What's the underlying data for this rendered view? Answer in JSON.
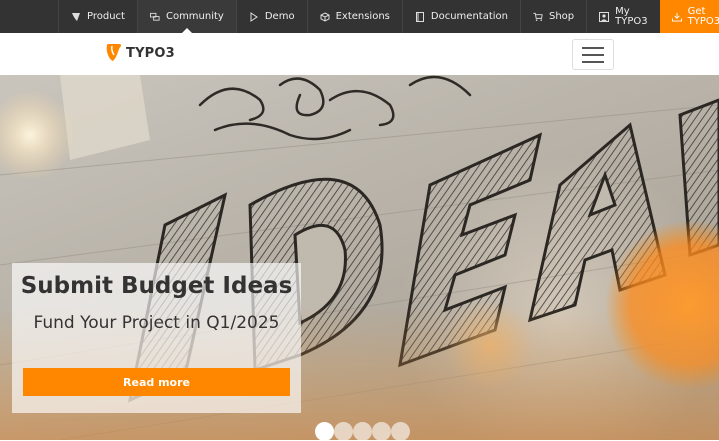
{
  "topnav": {
    "items": [
      {
        "label": "Product",
        "icon": "typo3-icon"
      },
      {
        "label": "Community",
        "icon": "community-icon"
      },
      {
        "label": "Demo",
        "icon": "play-icon"
      },
      {
        "label": "Extensions",
        "icon": "cube-icon"
      },
      {
        "label": "Documentation",
        "icon": "book-icon"
      },
      {
        "label": "Shop",
        "icon": "cart-icon"
      },
      {
        "label": "My TYPO3",
        "icon": "user-icon"
      }
    ],
    "cta": {
      "label": "Get TYPO3",
      "icon": "download-icon"
    },
    "accent": "#ff8700"
  },
  "header": {
    "logo_text": "TYPO3"
  },
  "hero": {
    "title": "Submit Budget Ideas",
    "subtitle": "Fund Your Project in Q1/2025",
    "button_label": "Read more",
    "slides_count": 5,
    "active_slide": 1
  }
}
